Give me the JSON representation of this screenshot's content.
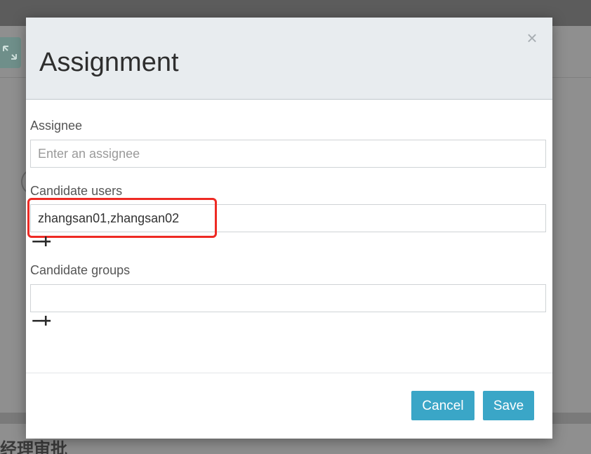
{
  "modal": {
    "title": "Assignment",
    "close_glyph": "×"
  },
  "fields": {
    "assignee": {
      "label": "Assignee",
      "value": "",
      "placeholder": "Enter an assignee"
    },
    "candidate_users": {
      "label": "Candidate users",
      "value": "zhangsan01,zhangsan02"
    },
    "candidate_groups": {
      "label": "Candidate groups",
      "value": ""
    }
  },
  "controls": {
    "minus": "−",
    "plus": "+"
  },
  "footer": {
    "cancel_label": "Cancel",
    "save_label": "Save"
  },
  "background": {
    "bottom_text": "经理审批"
  },
  "colors": {
    "accent": "#3aa6c7",
    "highlight": "#ee2a24",
    "header_bg": "#e8ecef"
  }
}
